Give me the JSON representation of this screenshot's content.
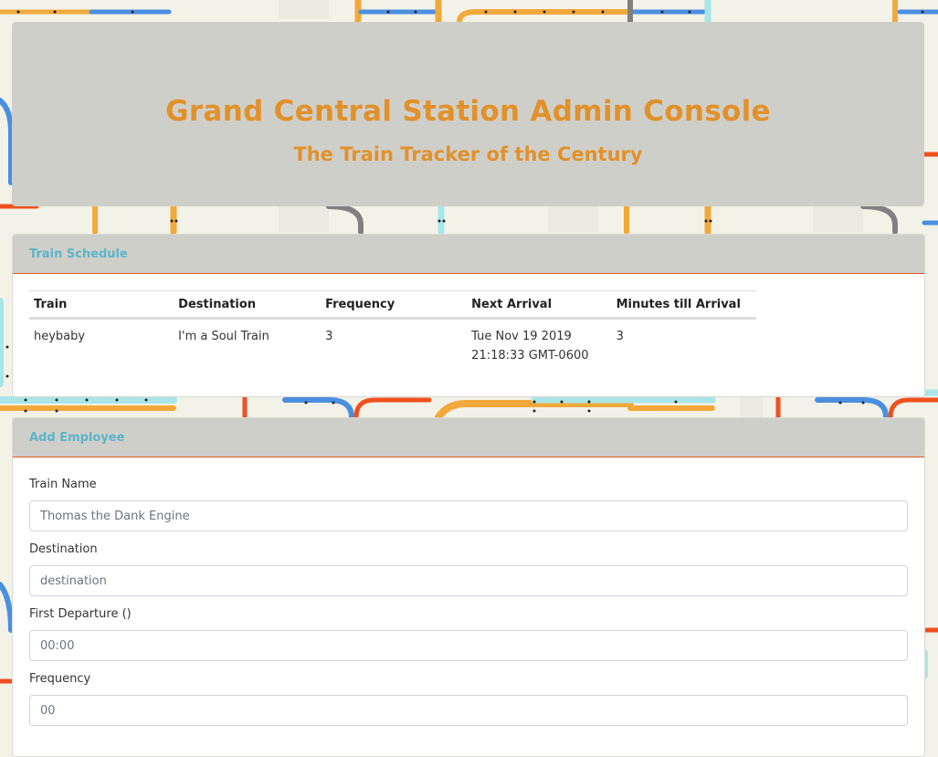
{
  "header": {
    "title": "Grand Central Station Admin Console",
    "subtitle": "The Train Tracker of the Century",
    "title_color": "#e2912a"
  },
  "schedule": {
    "heading": "Train Schedule",
    "columns": [
      "Train",
      "Destination",
      "Frequency",
      "Next Arrival",
      "Minutes till Arrival"
    ],
    "rows": [
      {
        "train": "heybaby",
        "destination": "I'm a Soul Train",
        "frequency": "3",
        "next_arrival": "Tue Nov 19 2019 21:18:33 GMT-0600",
        "minutes": "3"
      }
    ]
  },
  "add_form": {
    "heading": "Add Employee",
    "fields": [
      {
        "label": "Train Name",
        "placeholder": "Thomas the Dank Engine"
      },
      {
        "label": "Destination",
        "placeholder": "destination"
      },
      {
        "label": "First Departure ()",
        "placeholder": "00:00"
      },
      {
        "label": "Frequency",
        "placeholder": "00"
      }
    ]
  },
  "colors": {
    "header_bg": "#cfcfca",
    "accent_heading": "#5cb4c9",
    "divider": "#e05a1a",
    "page_bg": "#f3f2e8",
    "line_orange": "#f2a93b",
    "line_blue": "#4a8fe0",
    "line_red": "#f0501e",
    "line_cyan": "#a8e6e8",
    "line_gray": "#808080"
  }
}
